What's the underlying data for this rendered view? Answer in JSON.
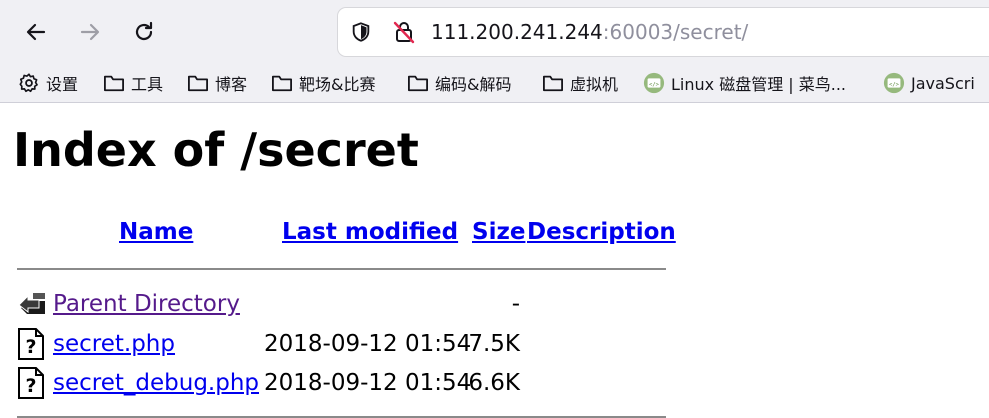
{
  "browser": {
    "url_host": "111.200.241.244",
    "url_rest": ":60003/secret/",
    "bookmarks": [
      {
        "label": "设置",
        "icon": "gear-icon"
      },
      {
        "label": "工具",
        "icon": "folder-icon"
      },
      {
        "label": "博客",
        "icon": "folder-icon"
      },
      {
        "label": "靶场&比赛",
        "icon": "folder-icon"
      },
      {
        "label": "编码&解码",
        "icon": "folder-icon"
      },
      {
        "label": "虚拟机",
        "icon": "folder-icon"
      },
      {
        "label": "Linux 磁盘管理 | 菜鸟...",
        "icon": "runoob-icon"
      },
      {
        "label": "JavaScri",
        "icon": "runoob-icon"
      }
    ]
  },
  "page": {
    "title": "Index of /secret",
    "columns": {
      "name": "Name",
      "last_modified": "Last modified",
      "size": "Size",
      "description": "Description"
    },
    "rows": [
      {
        "name": "Parent Directory",
        "date": "",
        "size": "-",
        "icon": "back-folder-icon",
        "visited": true
      },
      {
        "name": "secret.php",
        "date": "2018-09-12 01:54",
        "size": "7.5K",
        "icon": "unknown-file-icon",
        "visited": false
      },
      {
        "name": "secret_debug.php",
        "date": "2018-09-12 01:54",
        "size": "6.6K",
        "icon": "unknown-file-icon",
        "visited": false
      }
    ]
  },
  "colors": {
    "link": "#0000ee",
    "visited_link": "#551a8b",
    "chrome_bg": "#f0f0f4"
  }
}
